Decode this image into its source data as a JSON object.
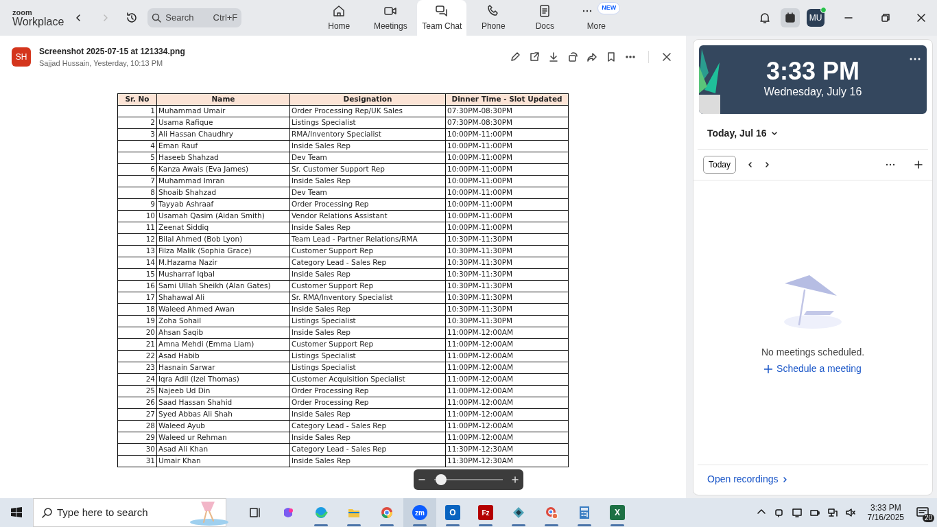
{
  "top_bar": {
    "logo_top": "zoom",
    "logo_bottom": "Workplace",
    "search": {
      "placeholder": "Search",
      "shortcut": "Ctrl+F"
    },
    "tabs": [
      {
        "label": "Home",
        "kind": "home",
        "selected": false
      },
      {
        "label": "Meetings",
        "kind": "video",
        "selected": false
      },
      {
        "label": "Team Chat",
        "kind": "chat",
        "selected": true
      },
      {
        "label": "Phone",
        "kind": "phone",
        "selected": false
      },
      {
        "label": "Docs",
        "kind": "doc",
        "selected": false
      },
      {
        "label": "More",
        "kind": "more",
        "selected": false,
        "badge": "NEW"
      }
    ],
    "avatar": "MU"
  },
  "file": {
    "avatar": "SH",
    "title": "Screenshot 2025-07-15 at 121334.png",
    "subtitle": "Sajjad Hussain, Yesterday, 10:13 PM"
  },
  "table": {
    "columns": [
      "Sr. No",
      "Name",
      "Designation",
      "Dinner Time - Slot Updated"
    ],
    "rows": [
      [
        "1",
        "Muhammad Umair",
        "Order Processing Rep/UK Sales",
        "07:30PM-08:30PM"
      ],
      [
        "2",
        "Usama Rafique",
        "Listings Specialist",
        "07:30PM-08:30PM"
      ],
      [
        "3",
        "Ali Hassan Chaudhry",
        "RMA/Inventory Specialist",
        "10:00PM-11:00PM"
      ],
      [
        "4",
        "Eman Rauf",
        "Inside Sales Rep",
        "10:00PM-11:00PM"
      ],
      [
        "5",
        "Haseeb Shahzad",
        "Dev Team",
        "10:00PM-11:00PM"
      ],
      [
        "6",
        "Kanza Awais (Eva James)",
        "Sr. Customer Support Rep",
        "10:00PM-11:00PM"
      ],
      [
        "7",
        "Muhammad Imran",
        "Inside Sales Rep",
        "10:00PM-11:00PM"
      ],
      [
        "8",
        "Shoaib Shahzad",
        "Dev Team",
        "10:00PM-11:00PM"
      ],
      [
        "9",
        "Tayyab Ashraaf",
        "Order Processing Rep",
        "10:00PM-11:00PM"
      ],
      [
        "10",
        "Usamah Qasim (Aidan Smith)",
        "Vendor Relations Assistant",
        "10:00PM-11:00PM"
      ],
      [
        "11",
        "Zeenat Siddiq",
        "Inside Sales Rep",
        "10:00PM-11:00PM"
      ],
      [
        "12",
        "Bilal Ahmed (Bob Lyon)",
        "Team Lead - Partner Relations/RMA",
        "10:30PM-11:30PM"
      ],
      [
        "13",
        "Filza Malik (Sophia Grace)",
        "Customer Support Rep",
        "10:30PM-11:30PM"
      ],
      [
        "14",
        "M.Hazama Nazir",
        "Category Lead - Sales Rep",
        "10:30PM-11:30PM"
      ],
      [
        "15",
        "Musharraf Iqbal",
        "Inside Sales Rep",
        "10:30PM-11:30PM"
      ],
      [
        "16",
        "Sami Ullah Sheikh (Alan Gates)",
        "Customer Support Rep",
        "10:30PM-11:30PM"
      ],
      [
        "17",
        "Shahawal Ali",
        "Sr. RMA/Inventory Specialist",
        "10:30PM-11:30PM"
      ],
      [
        "18",
        "Waleed Ahmed Awan",
        "Inside Sales Rep",
        "10:30PM-11:30PM"
      ],
      [
        "19",
        "Zoha Sohail",
        "Listings Specialist",
        "10:30PM-11:30PM"
      ],
      [
        "20",
        "Ahsan Saqib",
        "Inside Sales Rep",
        "11:00PM-12:00AM"
      ],
      [
        "21",
        "Amna Mehdi (Emma Liam)",
        "Customer Support Rep",
        "11:00PM-12:00AM"
      ],
      [
        "22",
        "Asad Habib",
        "Listings Specialist",
        "11:00PM-12:00AM"
      ],
      [
        "23",
        "Hasnain Sarwar",
        "Listings Specialist",
        "11:00PM-12:00AM"
      ],
      [
        "24",
        "Iqra Adil (Izel Thomas)",
        "Customer Acquisition Specialist",
        "11:00PM-12:00AM"
      ],
      [
        "25",
        "Najeeb Ud Din",
        "Order Processing Rep",
        "11:00PM-12:00AM"
      ],
      [
        "26",
        "Saad Hassan Shahid",
        "Order Processing Rep",
        "11:00PM-12:00AM"
      ],
      [
        "27",
        "Syed Abbas Ali Shah",
        "Inside Sales Rep",
        "11:00PM-12:00AM"
      ],
      [
        "28",
        "Waleed Ayub",
        "Category Lead - Sales Rep",
        "11:00PM-12:00AM"
      ],
      [
        "29",
        "Waleed ur Rehman",
        "Inside Sales Rep",
        "11:00PM-12:00AM"
      ],
      [
        "30",
        "Asad Ali Khan",
        "Category Lead - Sales Rep",
        "11:30PM-12:30AM"
      ],
      [
        "31",
        "Umair Khan",
        "Inside Sales Rep",
        "11:30PM-12:30AM"
      ]
    ]
  },
  "zoom_slider": {
    "level": 0.1
  },
  "calendar": {
    "time": "3:33 PM",
    "date": "Wednesday, July 16",
    "day_label": "Today, Jul 16",
    "today_button": "Today",
    "empty_text": "No meetings scheduled.",
    "schedule_link": "Schedule a meeting",
    "recordings_link": "Open recordings"
  },
  "taskbar": {
    "search_placeholder": "Type here to search",
    "apps": [
      {
        "kind": "taskview",
        "selected": false,
        "running": false
      },
      {
        "kind": "copilot",
        "selected": false,
        "running": false
      },
      {
        "kind": "edge",
        "selected": false,
        "running": true
      },
      {
        "kind": "folder",
        "selected": false,
        "running": true
      },
      {
        "kind": "chrome",
        "selected": false,
        "running": true
      },
      {
        "kind": "zoom",
        "label": "zm",
        "selected": true,
        "running": true
      },
      {
        "kind": "outlook",
        "label": "O",
        "selected": false,
        "running": true
      },
      {
        "kind": "filezilla",
        "label": "Fz",
        "selected": false,
        "running": true
      },
      {
        "kind": "diamond",
        "selected": false,
        "running": true
      },
      {
        "kind": "chrome2",
        "selected": false,
        "running": true
      },
      {
        "kind": "calculator",
        "selected": false,
        "running": true
      },
      {
        "kind": "excel",
        "label": "X",
        "selected": false,
        "running": true
      }
    ],
    "time": "3:33 PM",
    "date": "7/16/2025",
    "notifications": "20"
  }
}
